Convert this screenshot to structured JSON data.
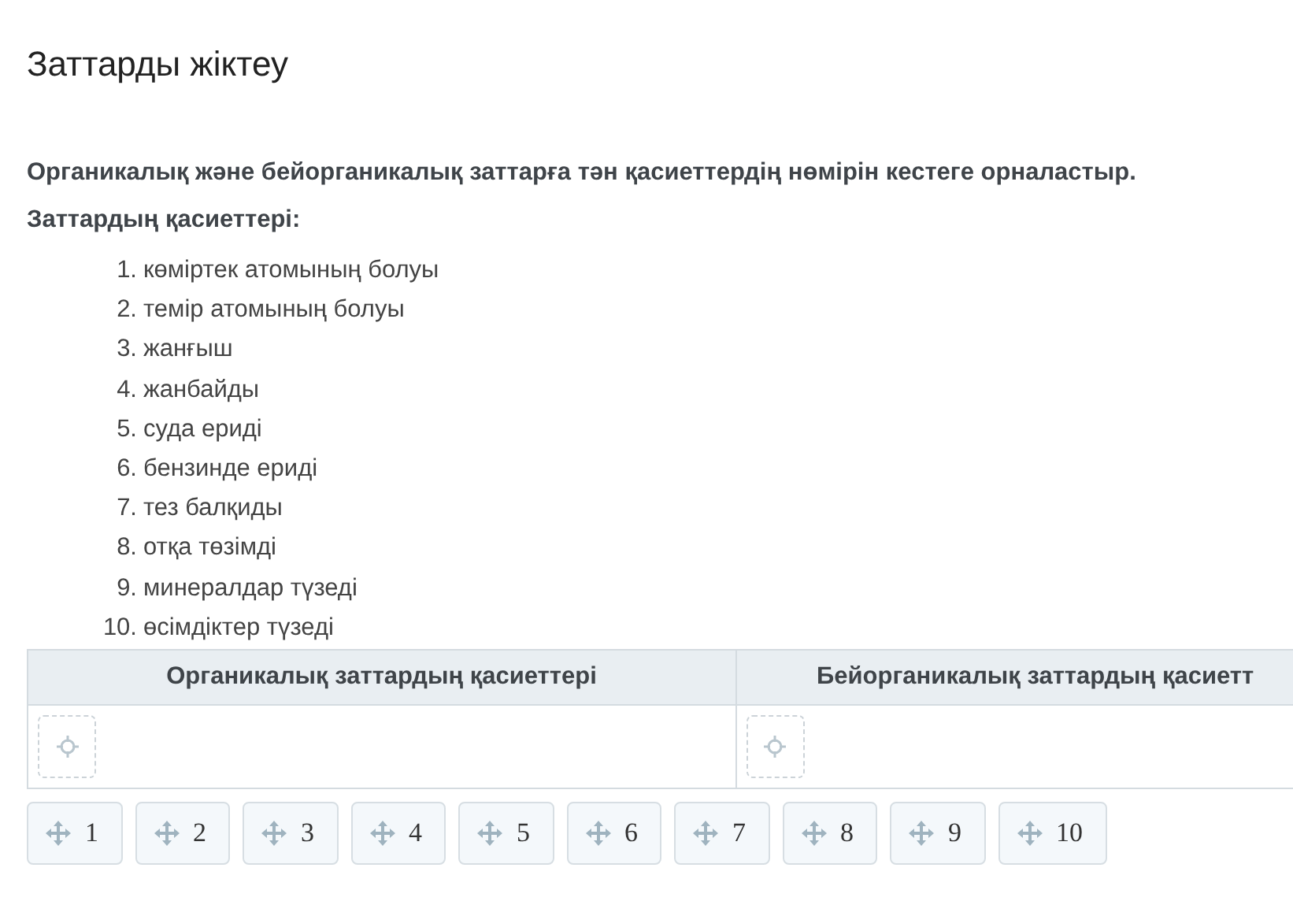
{
  "title": "Заттарды жіктеу",
  "instruction": "Органикалық және бейорганикалық заттарға тән қасиеттердің нөмірін кестеге орналастыр.",
  "properties_label": "Заттардың қасиеттері:",
  "properties": [
    {
      "marker": "1.",
      "text": "көміртек атомының болуы"
    },
    {
      "marker": "2.",
      "text": "темір атомының болуы"
    },
    {
      "marker": "3.",
      "text": "жанғыш"
    },
    {
      "marker": "4.",
      "text": "жанбайды"
    },
    {
      "marker": "5.",
      "text": "суда ериді"
    },
    {
      "marker": "6.",
      "text": "бензинде ериді"
    },
    {
      "marker": "7.",
      "text": "тез балқиды"
    },
    {
      "marker": "8.",
      "text": "отқа төзімді"
    },
    {
      "marker": "9.",
      "text": "минералдар түзеді"
    },
    {
      "marker": "10.",
      "text": "өсімдіктер түзеді"
    }
  ],
  "table": {
    "columns": [
      "Органикалық заттардың қасиеттері",
      "Бейорганикалық заттардың қасиетт"
    ]
  },
  "chips": [
    "1",
    "2",
    "3",
    "4",
    "5",
    "6",
    "7",
    "8",
    "9",
    "10"
  ]
}
